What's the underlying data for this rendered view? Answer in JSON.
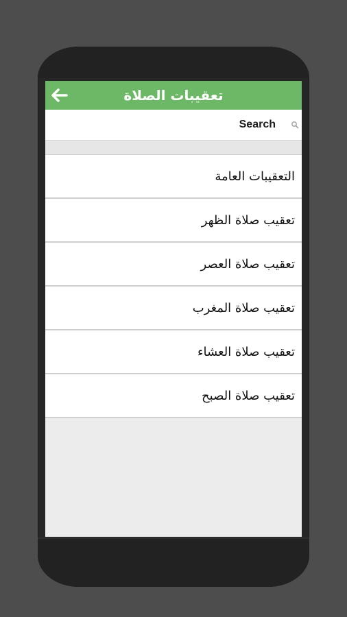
{
  "app": {
    "title": "تعقيبات الصلاة",
    "colors": {
      "accent": "#6db866",
      "background": "#4d4d4d"
    },
    "back_icon": "arrow-left-icon"
  },
  "search": {
    "label": "Search",
    "icon": "search-icon"
  },
  "list": {
    "items": [
      {
        "label": "التعقيبات العامة"
      },
      {
        "label": "تعقيب صلاة الظهر"
      },
      {
        "label": "تعقيب صلاة العصر"
      },
      {
        "label": "تعقيب صلاة المغرب"
      },
      {
        "label": "تعقيب صلاة العشاء"
      },
      {
        "label": "تعقيب صلاة الصبح"
      }
    ]
  }
}
